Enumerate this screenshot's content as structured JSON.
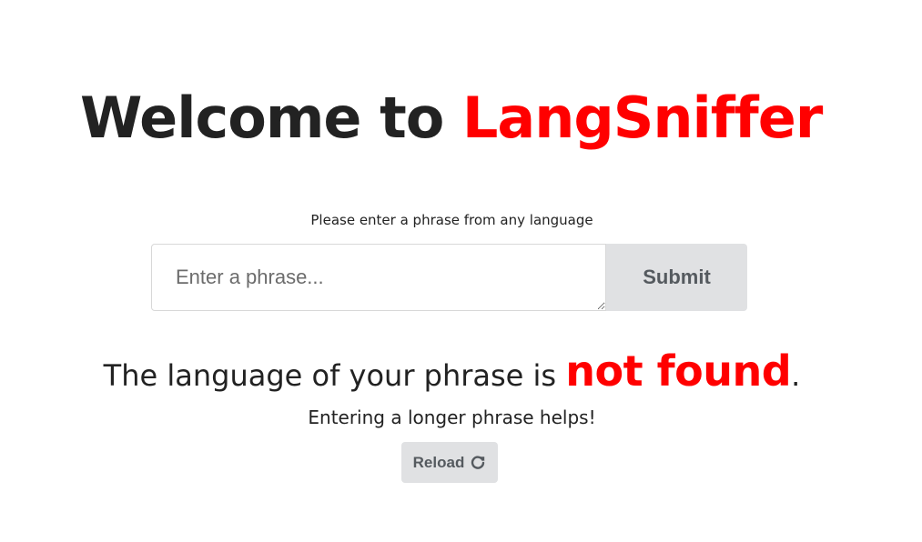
{
  "header": {
    "title_prefix": "Welcome to ",
    "brand": "LangSniffer"
  },
  "form": {
    "prompt": "Please enter a phrase from any language",
    "input_value": "",
    "input_placeholder": "Enter a phrase...",
    "submit_label": "Submit"
  },
  "result": {
    "prefix": "The language of your phrase is ",
    "status": "not found",
    "suffix": ".",
    "hint": "Entering a longer phrase helps!"
  },
  "actions": {
    "reload_label": "Reload",
    "reload_icon": "redo-icon"
  },
  "colors": {
    "accent": "#ff0000",
    "text": "#222222",
    "button_bg": "#e0e1e3",
    "button_text": "#555a5f"
  }
}
